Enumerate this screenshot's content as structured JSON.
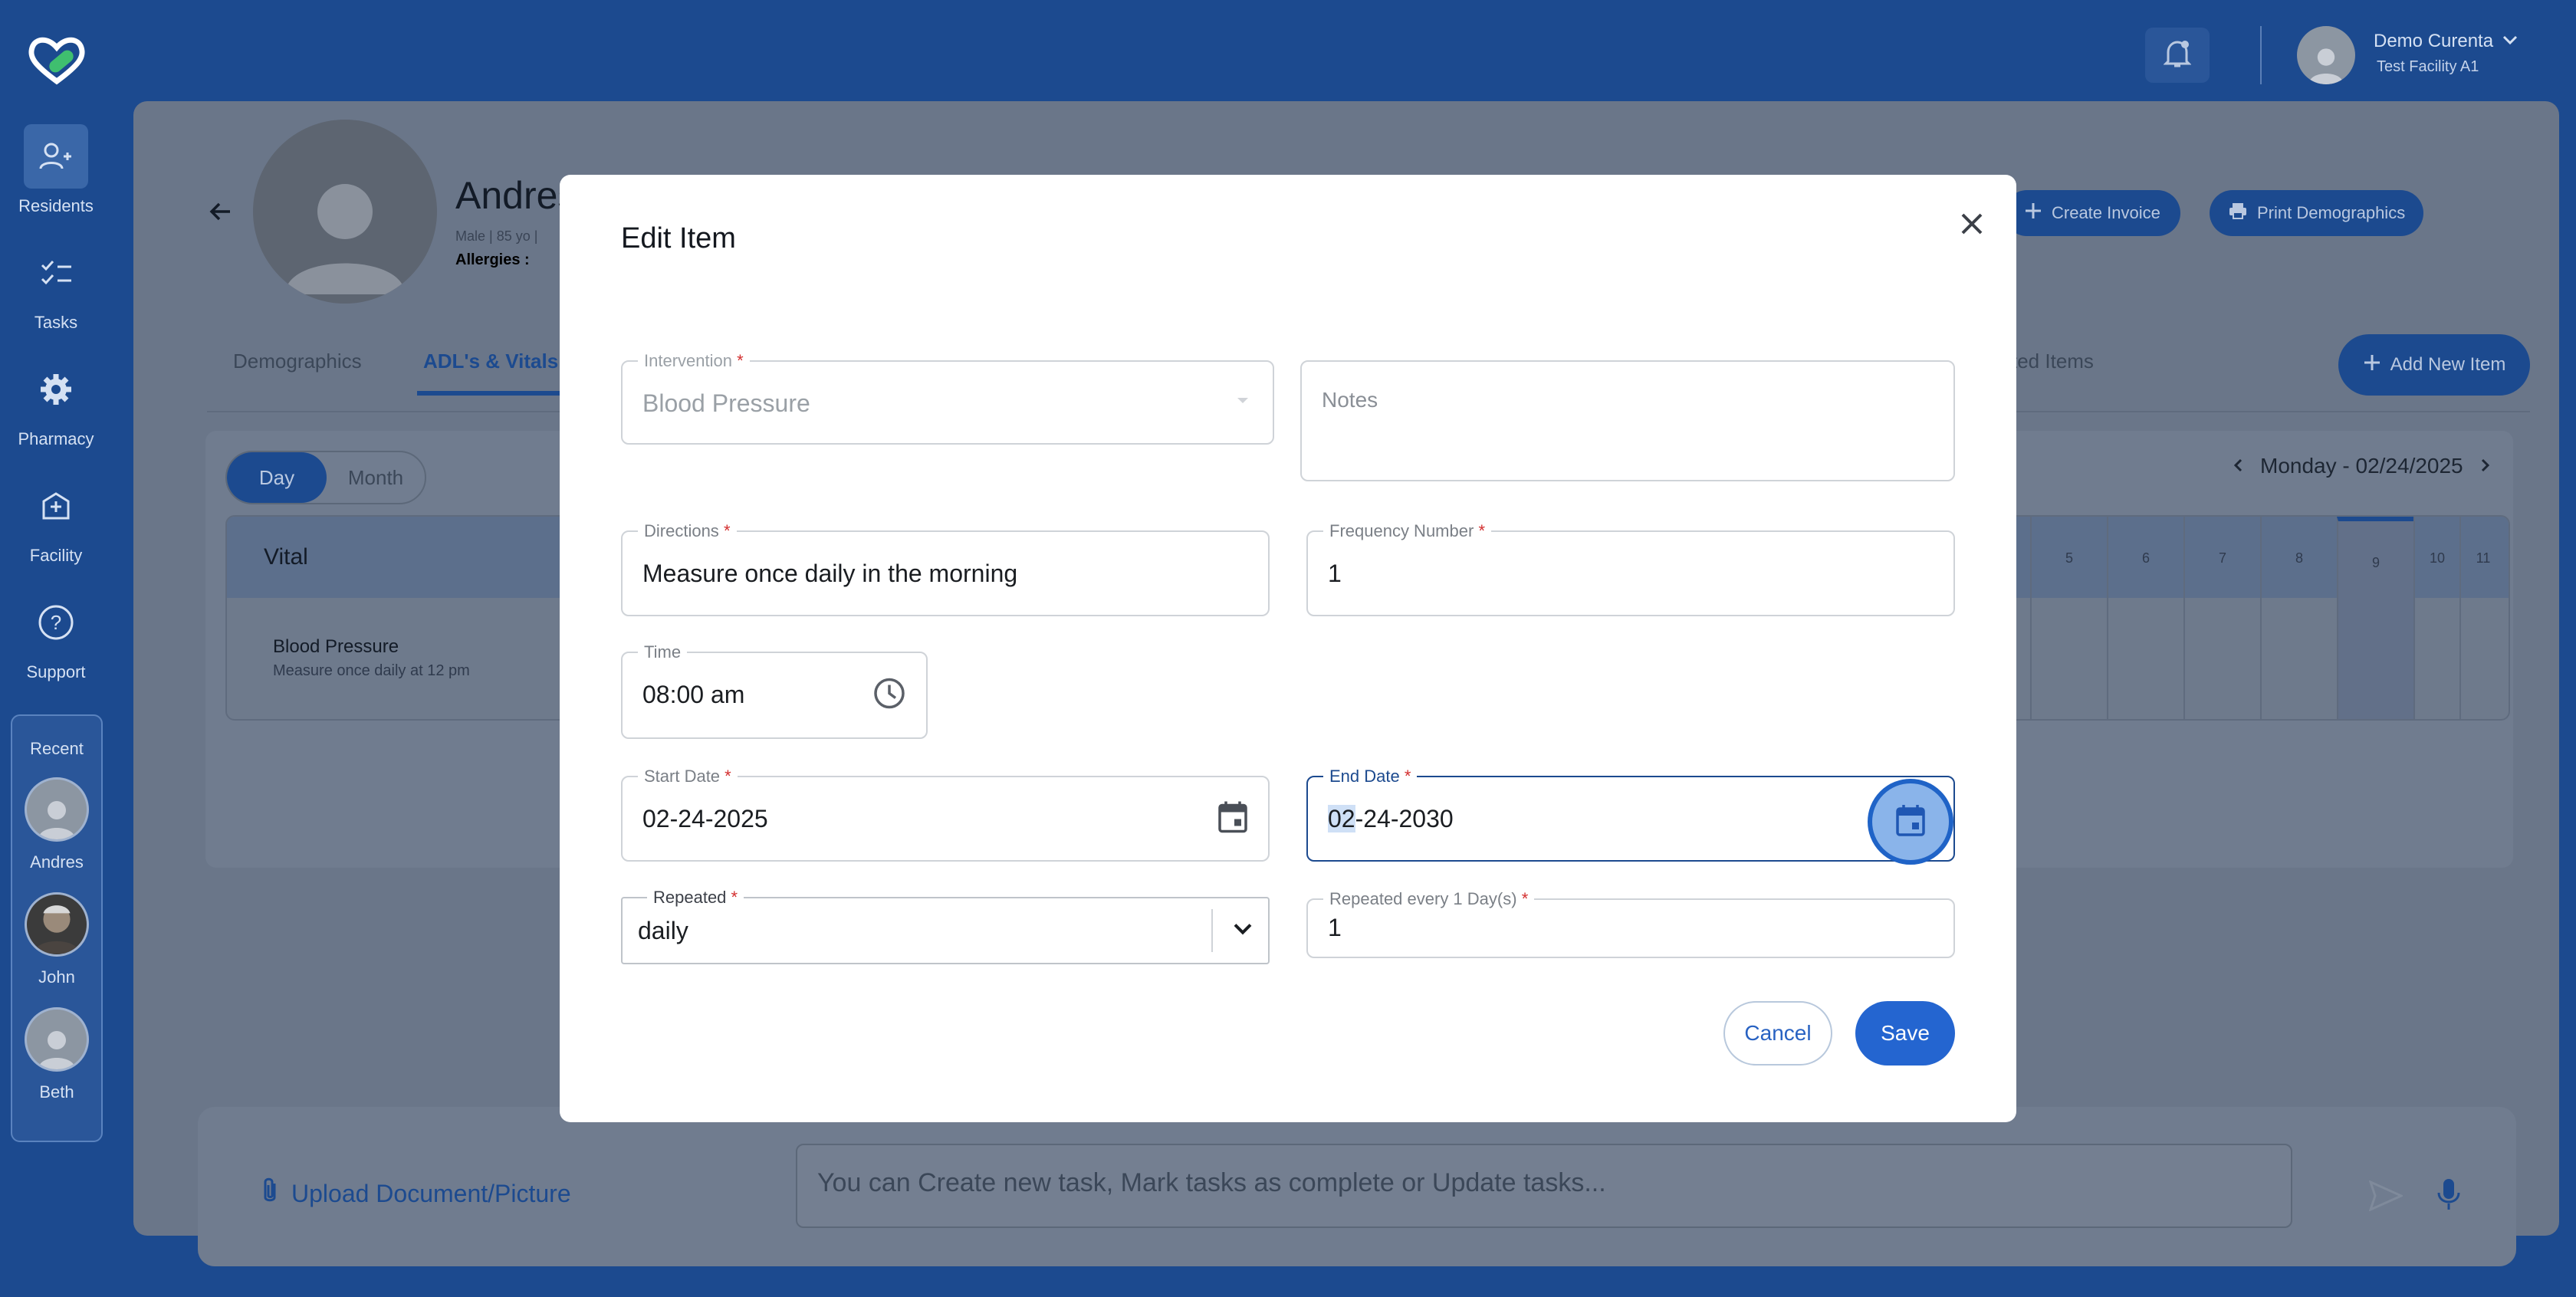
{
  "sidebar": {
    "items": [
      {
        "label": "Residents",
        "icon": "residents-icon"
      },
      {
        "label": "Tasks",
        "icon": "tasks-icon"
      },
      {
        "label": "Pharmacy",
        "icon": "gear-icon"
      },
      {
        "label": "Facility",
        "icon": "facility-icon"
      },
      {
        "label": "Support",
        "icon": "help-icon"
      }
    ],
    "recent_title": "Recent",
    "recent": [
      {
        "name": "Andres"
      },
      {
        "name": "John"
      },
      {
        "name": "Beth"
      }
    ]
  },
  "header": {
    "user_name": "Demo Curenta",
    "facility": "Test Facility A1"
  },
  "profile": {
    "name": "Andres",
    "meta": "Male | 85 yo |",
    "allergies_label": "Allergies :"
  },
  "actions": {
    "create_invoice": "Create Invoice",
    "print_demographics": "Print Demographics",
    "add_new_item": "Add New Item"
  },
  "tabs": [
    {
      "label": "Demographics"
    },
    {
      "label": "ADL's & Vitals"
    },
    {
      "label": "ted Items"
    }
  ],
  "schedule": {
    "toggle_day": "Day",
    "toggle_month": "Month",
    "date": "Monday - 02/24/2025",
    "vital_header": "Vital",
    "hours": [
      "5",
      "6",
      "7",
      "8",
      "9",
      "10",
      "11"
    ],
    "current_hour": "9",
    "row": {
      "title": "Blood Pressure",
      "subtitle": "Measure once daily at 12 pm"
    }
  },
  "bottom": {
    "upload_label": "Upload Document/Picture",
    "chat_placeholder": "You can Create new task, Mark tasks as complete or Update tasks..."
  },
  "modal": {
    "title": "Edit Item",
    "intervention": {
      "label": "Intervention",
      "value": "Blood Pressure"
    },
    "notes": {
      "placeholder": "Notes"
    },
    "directions": {
      "label": "Directions",
      "value": "Measure once daily in the morning"
    },
    "frequency": {
      "label": "Frequency Number",
      "value": "1"
    },
    "time": {
      "label": "Time",
      "value": "08:00 am"
    },
    "start_date": {
      "label": "Start Date",
      "value": "02-24-2025"
    },
    "end_date": {
      "label": "End Date",
      "value_selected": "02",
      "value_rest": "-24-2030"
    },
    "repeated": {
      "label": "Repeated",
      "value": "daily"
    },
    "repeated_every": {
      "label": "Repeated every 1 Day(s)",
      "value": "1"
    },
    "cancel": "Cancel",
    "save": "Save"
  },
  "colors": {
    "brand": "#1c4a8f",
    "primary_button": "#2465d0",
    "required": "#d32f2f"
  }
}
